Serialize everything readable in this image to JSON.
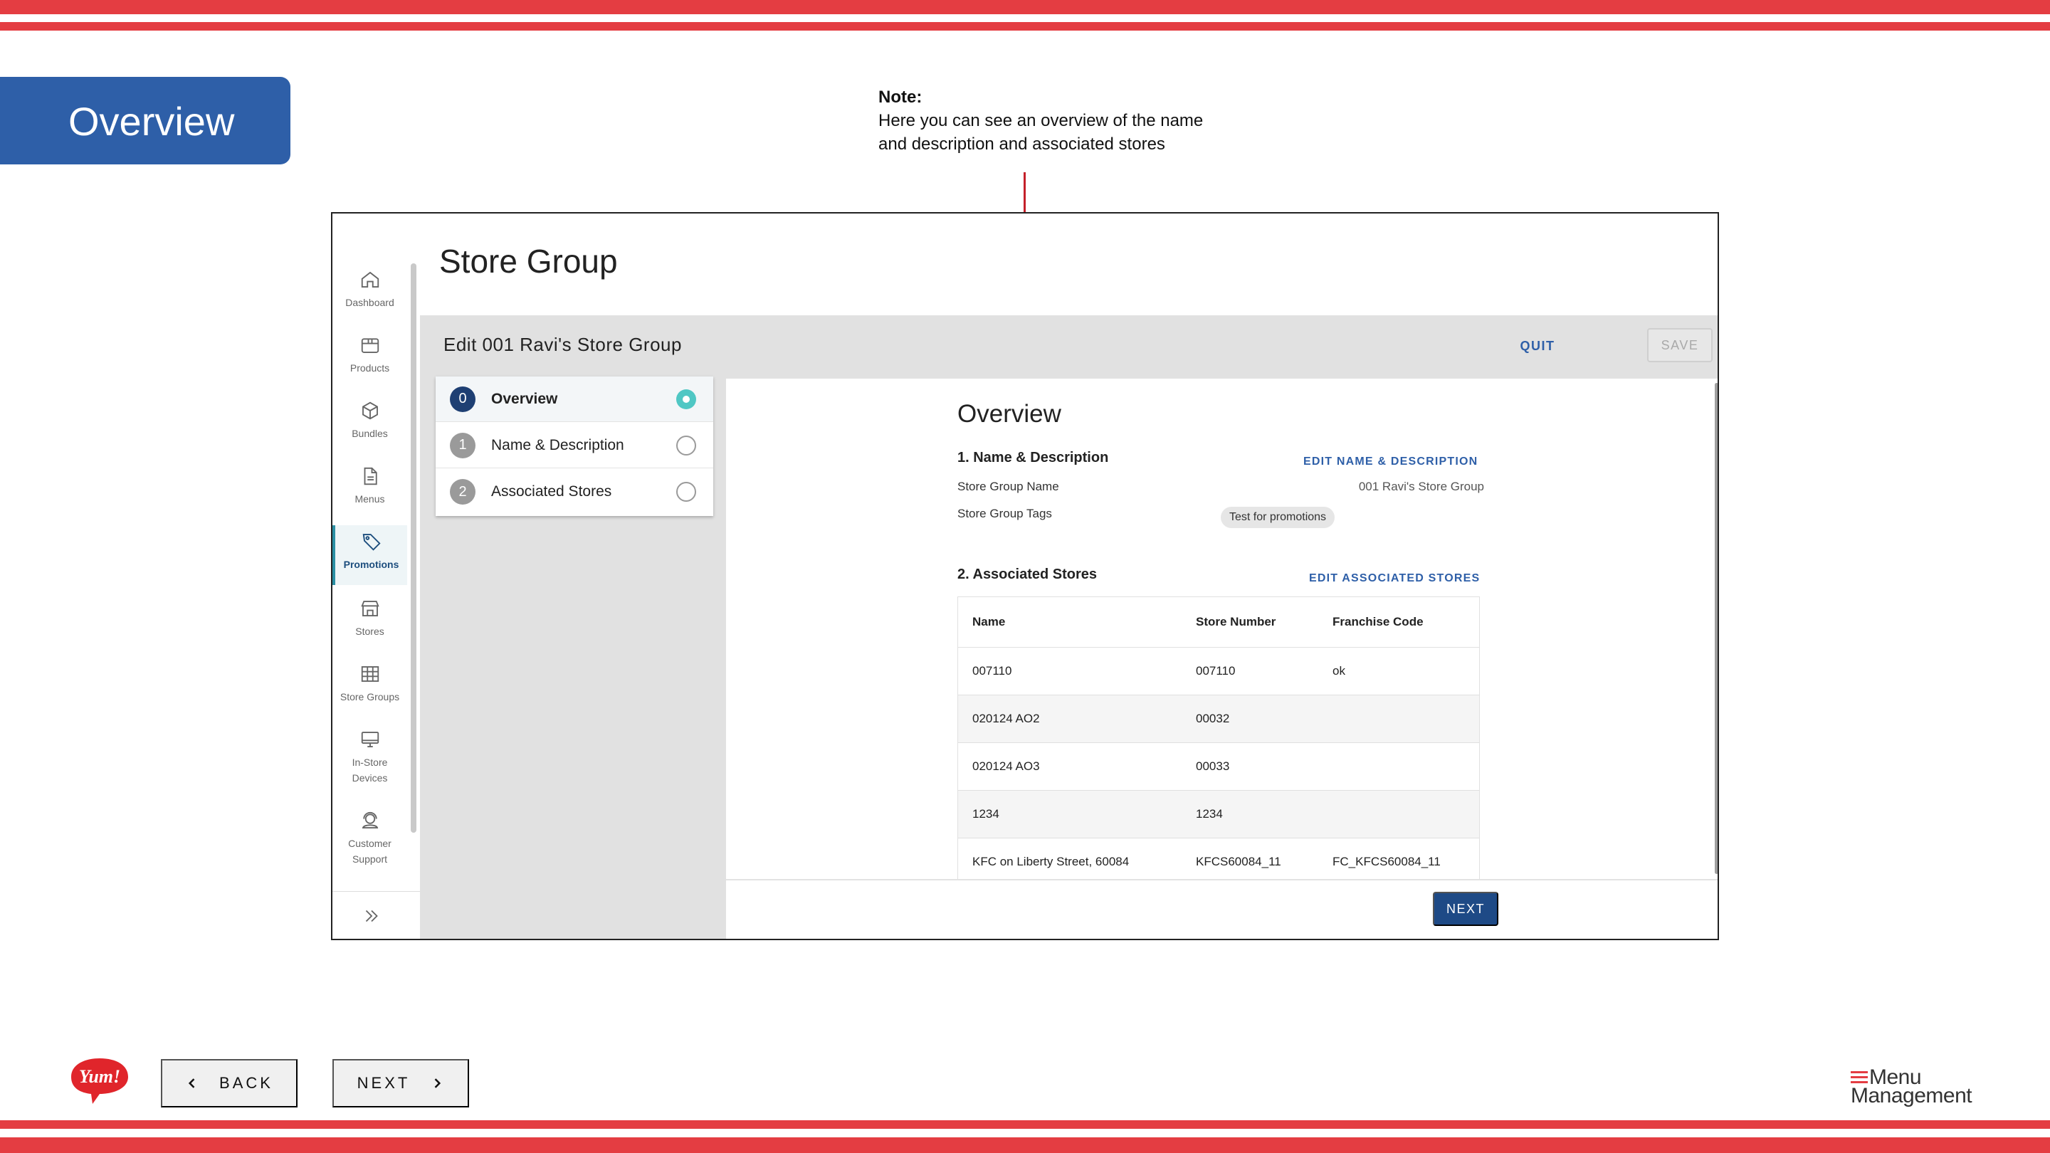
{
  "slide": {
    "title": "Overview",
    "note_heading": "Note:",
    "note_lines": [
      "Here you can see an overview of the name",
      "and description and associated stores"
    ]
  },
  "colors": {
    "stripe": "#e43d42",
    "title_tab": "#2e5fa8",
    "primary": "#1e4a86",
    "accent_teal": "#4fc7c4",
    "arrow": "#c4202a"
  },
  "sidebar": {
    "items": [
      {
        "label": "Dashboard",
        "icon": "home-icon"
      },
      {
        "label": "Products",
        "icon": "box-icon"
      },
      {
        "label": "Bundles",
        "icon": "cube-icon"
      },
      {
        "label": "Menus",
        "icon": "document-icon"
      },
      {
        "label": "Promotions",
        "icon": "tag-icon",
        "active": true
      },
      {
        "label": "Stores",
        "icon": "storefront-icon"
      },
      {
        "label": "Store Groups",
        "icon": "grid-icon"
      },
      {
        "label": "In-Store\nDevices",
        "icon": "monitor-icon"
      },
      {
        "label": "Customer\nSupport",
        "icon": "headset-icon"
      }
    ],
    "expand_icon": "double-chevron-right-icon"
  },
  "page": {
    "title": "Store Group"
  },
  "edit": {
    "title": "Edit 001 Ravi's Store Group",
    "quit_label": "QUIT",
    "save_label": "SAVE"
  },
  "steps": [
    {
      "num": "0",
      "label": "Overview",
      "active": true
    },
    {
      "num": "1",
      "label": "Name & Description"
    },
    {
      "num": "2",
      "label": "Associated Stores"
    }
  ],
  "overview": {
    "title": "Overview",
    "section1": {
      "heading": "1. Name & Description",
      "edit_link": "EDIT NAME & DESCRIPTION",
      "name_label": "Store Group Name",
      "name_value": "001 Ravi's Store Group",
      "tags_label": "Store Group Tags",
      "tag": "Test for promotions"
    },
    "section2": {
      "heading": "2. Associated Stores",
      "edit_link": "EDIT ASSOCIATED STORES",
      "columns": [
        "Name",
        "Store Number",
        "Franchise Code"
      ],
      "rows": [
        [
          "007110",
          "007110",
          "ok"
        ],
        [
          "020124 AO2",
          "00032",
          ""
        ],
        [
          "020124 AO3",
          "00033",
          ""
        ],
        [
          "1234",
          "1234",
          ""
        ],
        [
          "KFC on Liberty Street, 60084",
          "KFCS60084_11",
          "FC_KFCS60084_11"
        ]
      ]
    },
    "next_label": "NEXT"
  },
  "footer": {
    "back_label": "BACK",
    "next_label": "NEXT",
    "yum_logo_text": "Yum!",
    "mm_logo_line1": "Menu",
    "mm_logo_line2": "Management"
  }
}
